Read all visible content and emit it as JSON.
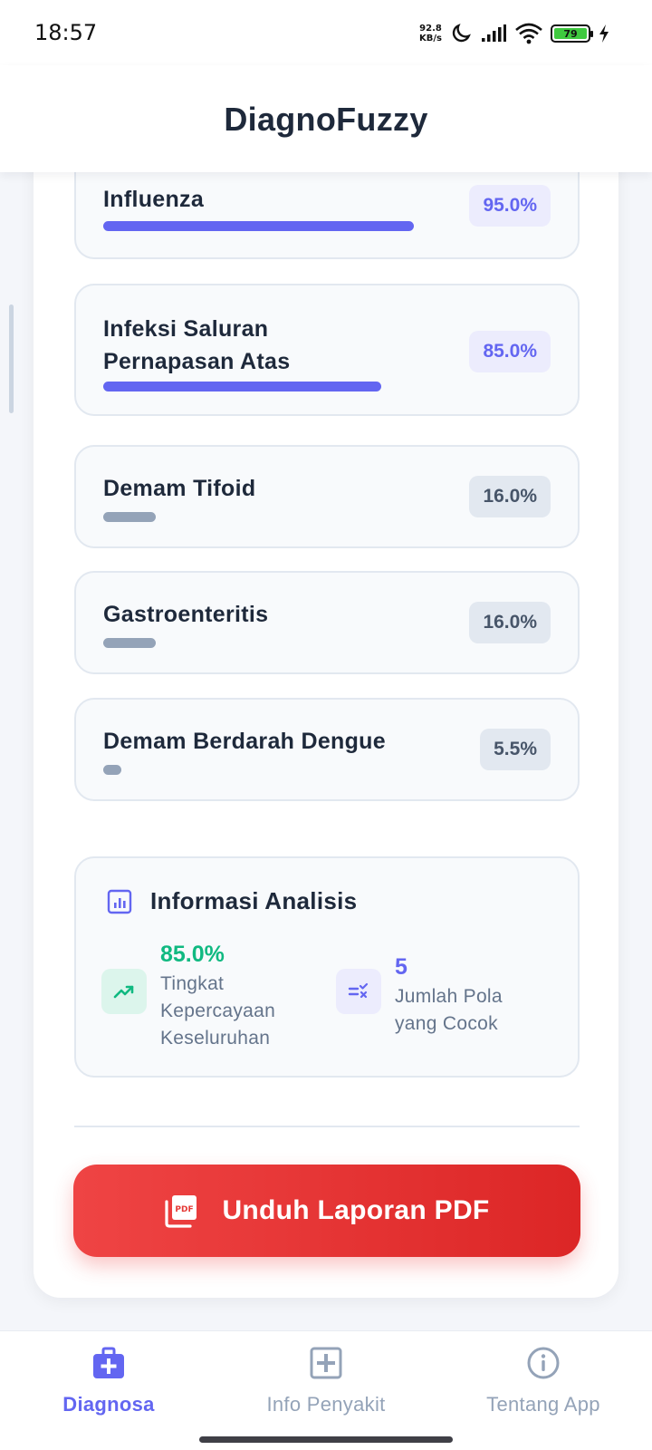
{
  "status_bar": {
    "time": "18:57",
    "net_speed_value": "92.8",
    "net_speed_unit": "KB/s",
    "battery": "79",
    "icons": [
      "moon-icon",
      "signal-icon",
      "wifi-icon",
      "battery-icon",
      "charging-icon"
    ]
  },
  "app": {
    "title": "DiagnoFuzzy"
  },
  "results": [
    {
      "name": "Influenza",
      "percent_label": "95.0%",
      "percent": 95.0,
      "tier": "high"
    },
    {
      "name": "Infeksi Saluran Pernapasan Atas",
      "percent_label": "85.0%",
      "percent": 85.0,
      "tier": "high"
    },
    {
      "name": "Demam Tifoid",
      "percent_label": "16.0%",
      "percent": 16.0,
      "tier": "low"
    },
    {
      "name": "Gastroenteritis",
      "percent_label": "16.0%",
      "percent": 16.0,
      "tier": "low"
    },
    {
      "name": "Demam Berdarah Dengue",
      "percent_label": "5.5%",
      "percent": 5.5,
      "tier": "low"
    }
  ],
  "info": {
    "title": "Informasi Analisis",
    "confidence_value": "85.0%",
    "confidence_label": "Tingkat Kepercayaan Keseluruhan",
    "patterns_value": "5",
    "patterns_label": "Jumlah Pola yang Cocok"
  },
  "actions": {
    "pdf_label": "Unduh Laporan PDF"
  },
  "nav": {
    "items": [
      {
        "label": "Diagnosa",
        "icon": "medical-kit-icon",
        "active": true
      },
      {
        "label": "Info Penyakit",
        "icon": "medical-plus-icon",
        "active": false
      },
      {
        "label": "Tentang App",
        "icon": "info-icon",
        "active": false
      }
    ]
  },
  "colors": {
    "primary": "#6366f1",
    "high_badge_bg": "#ececfd",
    "low_bar": "#94a3b8",
    "low_badge_bg": "#e2e8f0",
    "success": "#10b981",
    "danger": "#ef4444",
    "nav_active": "#6366f1",
    "nav_inactive": "#94a3b8"
  }
}
